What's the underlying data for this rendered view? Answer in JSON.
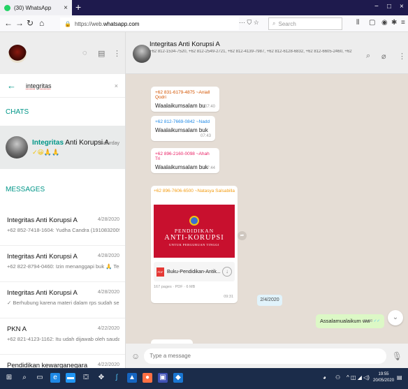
{
  "browser": {
    "tab_title": "(30) WhatsApp",
    "tab_close": "×",
    "new_tab": "+",
    "url_scheme": "https://web.",
    "url_domain": "whatsapp.com",
    "page_actions": "··· ⛉ ☆",
    "search_placeholder": "Search",
    "window_controls": [
      "−",
      "□",
      "×"
    ]
  },
  "search": {
    "query": "integritas",
    "clear": "×"
  },
  "sections": {
    "chats": "CHATS",
    "messages": "MESSAGES"
  },
  "chat_hit": {
    "name_match": "Integritas",
    "name_rest": " Anti Korupsi A",
    "emoji": "✓😀🙏🙏",
    "date": "Saturday"
  },
  "message_results": [
    {
      "name": "Integritas Anti Korupsi A",
      "date": "4/28/2020",
      "snippet": "+62 852-7418-1604: Yudha Candra (1910832009) Izin ..."
    },
    {
      "name": "Integritas Anti Korupsi A",
      "date": "4/28/2020",
      "snippet": "+62 822-8794-0460: Izin menanggapi buk 🙏 Tentu dal..."
    },
    {
      "name": "Integritas Anti Korupsi A",
      "date": "4/28/2020",
      "snippet": "✓ Berhubung karena materi dalam rps sudah selesai kita..."
    },
    {
      "name": "PKN A",
      "date": "4/22/2020",
      "snippet": "+62 821-4123-1162: Itu udah dijawab oleh saudara Arif ..."
    },
    {
      "name": "Pendidikan kewarganegara",
      "date": "4/22/2020",
      "snippet": ""
    }
  ],
  "conversation": {
    "name": "Integritas Anti Korupsi A",
    "members": "+62 812-1534-7520, +62 812-2549-2721, +62 812-4139-7987, +62 812-6128-6832, +62 812-6605-2460, +62 812-6899-0"
  },
  "messages": [
    {
      "sender": "+62 831-6179-4875 ~Aniall Qodri",
      "sender_color": "#d35400",
      "text": "Waalaikumsalam bu",
      "time": "07:40"
    },
    {
      "sender": "+62 812-7669-0842 ~Nadd",
      "sender_color": "#1e88e5",
      "text": "Waalaikumsalam buk",
      "time": "07:43"
    },
    {
      "sender": "+62 896-2160-0098 ~Ahah Tri",
      "sender_color": "#e91e63",
      "text": "Waalaikumsalam buk",
      "time": "07:44"
    }
  ],
  "document": {
    "sender": "+62 896-7606-6500 ~Natasya Salsabilla Fe...",
    "sender_color": "#f39c12",
    "title_1": "PENDIDIKAN",
    "title_2": "ANTI-KORUPSI",
    "title_3": "UNTUK PERGURUAN TINGGI",
    "pdf_label": "PDF",
    "filename": "Buku-Pendidikan-Antik...",
    "meta": "167 pages · PDF · 6 MB",
    "time": "09:31"
  },
  "date_chip": "2/4/2020",
  "outgoing": {
    "text": "Assalamualaikum ww",
    "time": "11:58",
    "ticks": "✓✓"
  },
  "composer": {
    "placeholder": "Type a message"
  },
  "clock": {
    "time": "19:55",
    "date": "20/05/2020"
  },
  "colors": {
    "accent": "#009688",
    "chat_bg": "#e5ddd5",
    "outgoing": "#dcf8c6",
    "taskbar": "#1b2c4a"
  }
}
